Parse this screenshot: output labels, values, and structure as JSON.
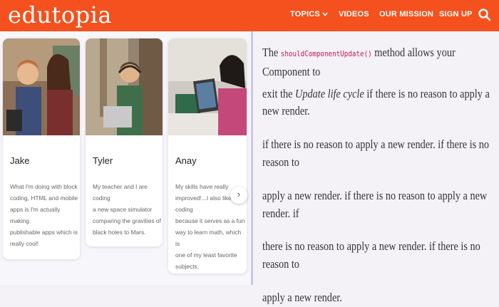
{
  "header": {
    "logo": "edutopia",
    "nav": [
      {
        "label": "TOPICS",
        "has_dropdown": true
      },
      {
        "label": "VIDEOS"
      },
      {
        "label": "OUR MISSION"
      },
      {
        "label": "SIGN UP"
      }
    ],
    "search_icon": "search-icon"
  },
  "cards": [
    {
      "name": "Jake",
      "quote_lines": [
        "What I'm doing with block",
        "coding, HTML and mobile",
        "apps is I'm actually making",
        "publishable apps which is",
        "really cool!"
      ]
    },
    {
      "name": "Tyler",
      "quote_lines": [
        "My teacher and I are coding",
        "a new space simulator",
        "comparing the gravities of",
        "black holes to Mars."
      ]
    },
    {
      "name": "Anay",
      "quote_lines": [
        "My skills have really",
        "improved!...I also like coding",
        "because it serves as a fun",
        "way to learn math, which is",
        "one of my least favorite",
        "subjects."
      ]
    }
  ],
  "carousel": {
    "next_glyph": "›"
  },
  "article": {
    "intro_the": "The",
    "method": "shouldComponentUpdate()",
    "line1_rest": "method allows your Component to",
    "line2_start": "exit the",
    "line2_em": "Update life cycle",
    "line2_rest": "if there is no reason to apply a new render.",
    "line3": "if there is no reason to apply a new render. if there is no reason to",
    "line4": "apply a new render. if there is no reason to apply a new render. if",
    "line5": "there is no reason to apply a new render. if there is no reason to",
    "line6": "apply a new render."
  },
  "colors": {
    "brand": "#f4511e",
    "code": "#c2185b",
    "divider": "#c9c9e3"
  }
}
